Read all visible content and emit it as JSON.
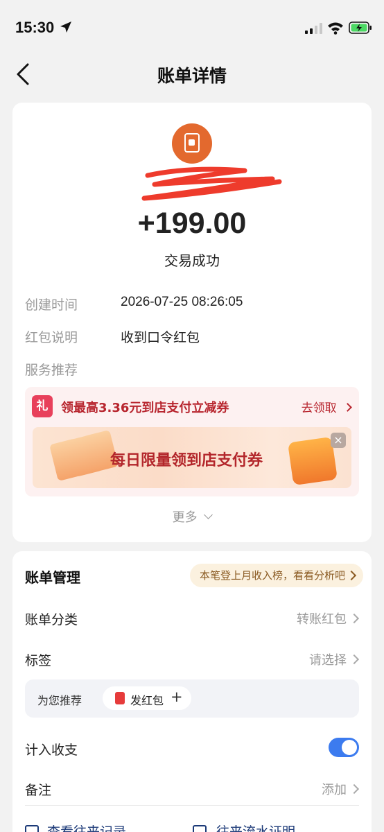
{
  "status_bar": {
    "time": "15:30"
  },
  "nav": {
    "title": "账单详情"
  },
  "transaction": {
    "amount": "+199.00",
    "status": "交易成功",
    "details": [
      {
        "label": "创建时间",
        "value": "2026-07-25 08:26:05"
      },
      {
        "label": "红包说明",
        "value": "收到口令红包"
      }
    ],
    "service_label": "服务推荐"
  },
  "promo": {
    "icon_text": "礼",
    "title": "领最高3.36元到店支付立减券",
    "link": "去领取",
    "banner_text": "每日限量领到店支付券",
    "banner_close": "×"
  },
  "more": {
    "label": "更多"
  },
  "management": {
    "title": "账单管理",
    "pill": "本笔登上月收入榜，看看分析吧",
    "category_label": "账单分类",
    "category_value": "转账红包",
    "tag_label": "标签",
    "tag_value": "请选择",
    "recommend_label": "为您推荐",
    "recommend_chip": "发红包",
    "recommend_plus": "+",
    "include_label": "计入收支",
    "include_enabled": true,
    "note_label": "备注",
    "note_value": "添加",
    "bottom_link_1": "查看往来记录",
    "bottom_link_2": "往来流水证明"
  },
  "colors": {
    "accent_orange": "#e3692e",
    "promo_red": "#b8262f",
    "toggle_blue": "#3c7bef",
    "link_navy": "#1c3a78"
  }
}
